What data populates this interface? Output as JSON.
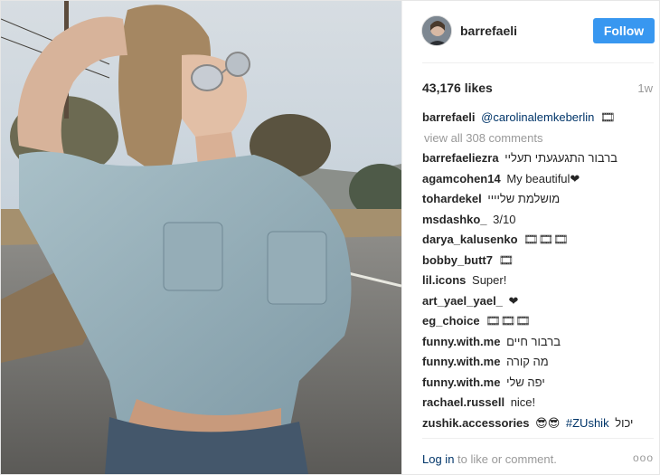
{
  "header": {
    "username": "barrefaeli",
    "follow_label": "Follow"
  },
  "stats": {
    "likes": "43,176 likes",
    "age": "1w"
  },
  "caption": {
    "user": "barrefaeli",
    "mention": "@carolinalemkeberlin",
    "emoji": "🎞"
  },
  "view_all": "view all 308 comments",
  "comments": [
    {
      "user": "barrefaeliezra",
      "text": "ברבור התגעגעתי תעליי"
    },
    {
      "user": "agamcohen14",
      "text": "My beautiful❤"
    },
    {
      "user": "tohardekel",
      "text": "מושלמת שליייי"
    },
    {
      "user": "msdashko_",
      "text": "3/10"
    },
    {
      "user": "darya_kalusenko",
      "text": "🎞🎞🎞"
    },
    {
      "user": "bobby_butt7",
      "text": "🎞"
    },
    {
      "user": "lil.icons",
      "text": "Super!"
    },
    {
      "user": "art_yael_yael_",
      "text": "❤"
    },
    {
      "user": "eg_choice",
      "text": "🎞🎞🎞"
    },
    {
      "user": "funny.with.me",
      "text": "ברבור חיים"
    },
    {
      "user": "funny.with.me",
      "text": "מה קורה"
    },
    {
      "user": "funny.with.me",
      "text": "יפה שלי"
    },
    {
      "user": "rachael.russell",
      "text": "nice!"
    },
    {
      "user": "zushik.accessories",
      "text": "😎😎",
      "mention": "#ZUshik",
      "text_after": "יכול"
    }
  ],
  "footer": {
    "login": "Log in",
    "rest": " to like or comment.",
    "more": "ooo"
  },
  "colors": {
    "follow_blue": "#3897f0",
    "link_blue": "#003569",
    "muted": "#999999"
  },
  "icons": {
    "more": "more-options-icon"
  }
}
